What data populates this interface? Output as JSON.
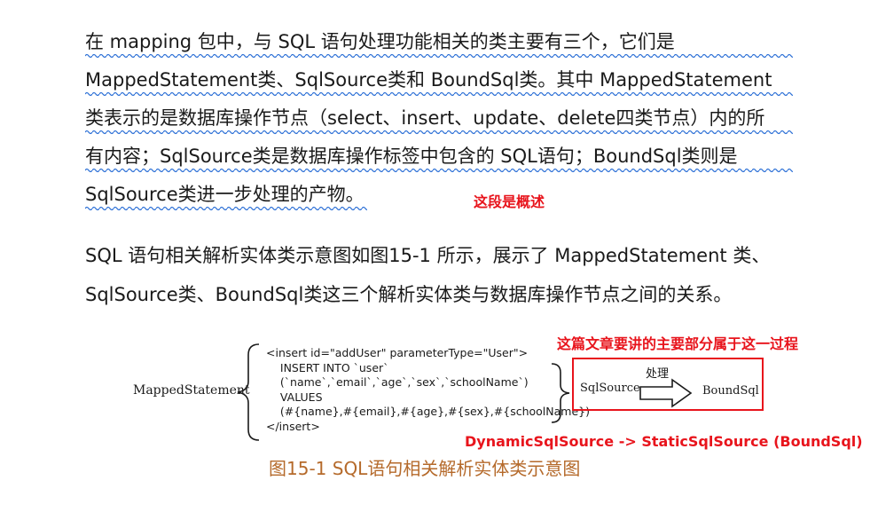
{
  "paragraph1": {
    "lines": [
      "在 mapping 包中，与 SQL 语句处理功能相关的类主要有三个，它们是",
      "MappedStatement类、SqlSource类和 BoundSql类。其中 MappedStatement",
      "类表示的是数据库操作节点（select、insert、update、delete四类节点）内的所",
      "有内容；SqlSource类是数据库操作标签中包含的 SQL语句；BoundSql类则是",
      "SqlSource类进一步处理的产物。"
    ],
    "annotation": "这段是概述"
  },
  "paragraph2": {
    "lines": [
      "SQL 语句相关解析实体类示意图如图15-1 所示，展示了 MappedStatement 类、",
      "SqlSource类、BoundSql类这三个解析实体类与数据库操作节点之间的关系。"
    ]
  },
  "diagram": {
    "mapped_statement_label": "MappedStatement",
    "code_lines": [
      "<insert id=\"addUser\" parameterType=\"User\">",
      "    INSERT INTO `user`",
      "    (`name`,`email`,`age`,`sex`,`schoolName`)",
      "    VALUES",
      "    (#{name},#{email},#{age},#{sex},#{schoolName})",
      "</insert>"
    ],
    "sqlsource_label": "SqlSource",
    "process_label": "处理",
    "boundsql_label": "BoundSql",
    "top_note": "这篇文章要讲的主要部分属于这一过程",
    "bottom_note": "DynamicSqlSource -> StaticSqlSource (BoundSql)",
    "accent_red": "#e8141c"
  },
  "caption": "图15-1 SQL语句相关解析实体类示意图"
}
